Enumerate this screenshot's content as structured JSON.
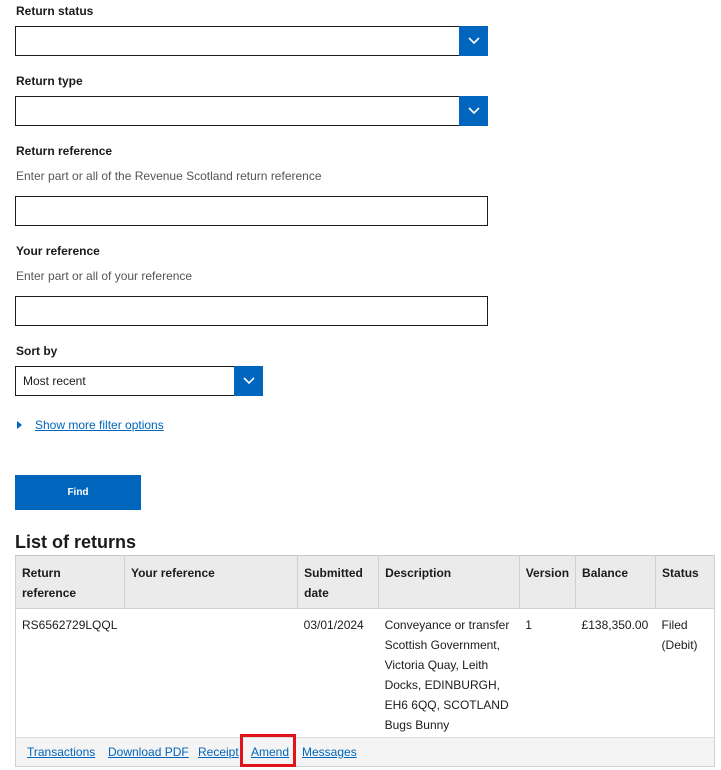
{
  "filters": {
    "return_status": {
      "label": "Return status",
      "value": ""
    },
    "return_type": {
      "label": "Return type",
      "value": ""
    },
    "return_reference": {
      "label": "Return reference",
      "hint": "Enter part or all of the Revenue Scotland return reference",
      "value": ""
    },
    "your_reference": {
      "label": "Your reference",
      "hint": "Enter part or all of your reference",
      "value": ""
    },
    "sort_by": {
      "label": "Sort by",
      "value": "Most recent"
    },
    "show_more": "Show more filter options",
    "find_button": "Find"
  },
  "list": {
    "title": "List of returns",
    "columns": {
      "return_reference": "Return reference",
      "your_reference": "Your reference",
      "submitted_date": "Submitted date",
      "description": "Description",
      "version": "Version",
      "balance": "Balance",
      "status": "Status"
    },
    "rows": [
      {
        "return_reference": "RS6562729LQQL",
        "your_reference": "",
        "submitted_date": "03/01/2024",
        "description_lines": [
          "Conveyance or transfer",
          "Scottish Government,",
          "Victoria Quay, Leith",
          "Docks, EDINBURGH,",
          "EH6 6QQ, SCOTLAND",
          "Bugs Bunny"
        ],
        "version": "1",
        "balance": "£138,350.00",
        "status_lines": [
          "Filed",
          "(Debit)"
        ]
      }
    ],
    "actions": {
      "transactions": "Transactions",
      "download_pdf": "Download PDF",
      "receipt": "Receipt",
      "amend": "Amend",
      "messages": "Messages"
    }
  },
  "colors": {
    "brand_blue": "#0065bd",
    "highlight_red": "#e0131a"
  },
  "icons": {
    "dropdown": "chevron-down-icon",
    "expander": "triangle-right-icon"
  }
}
